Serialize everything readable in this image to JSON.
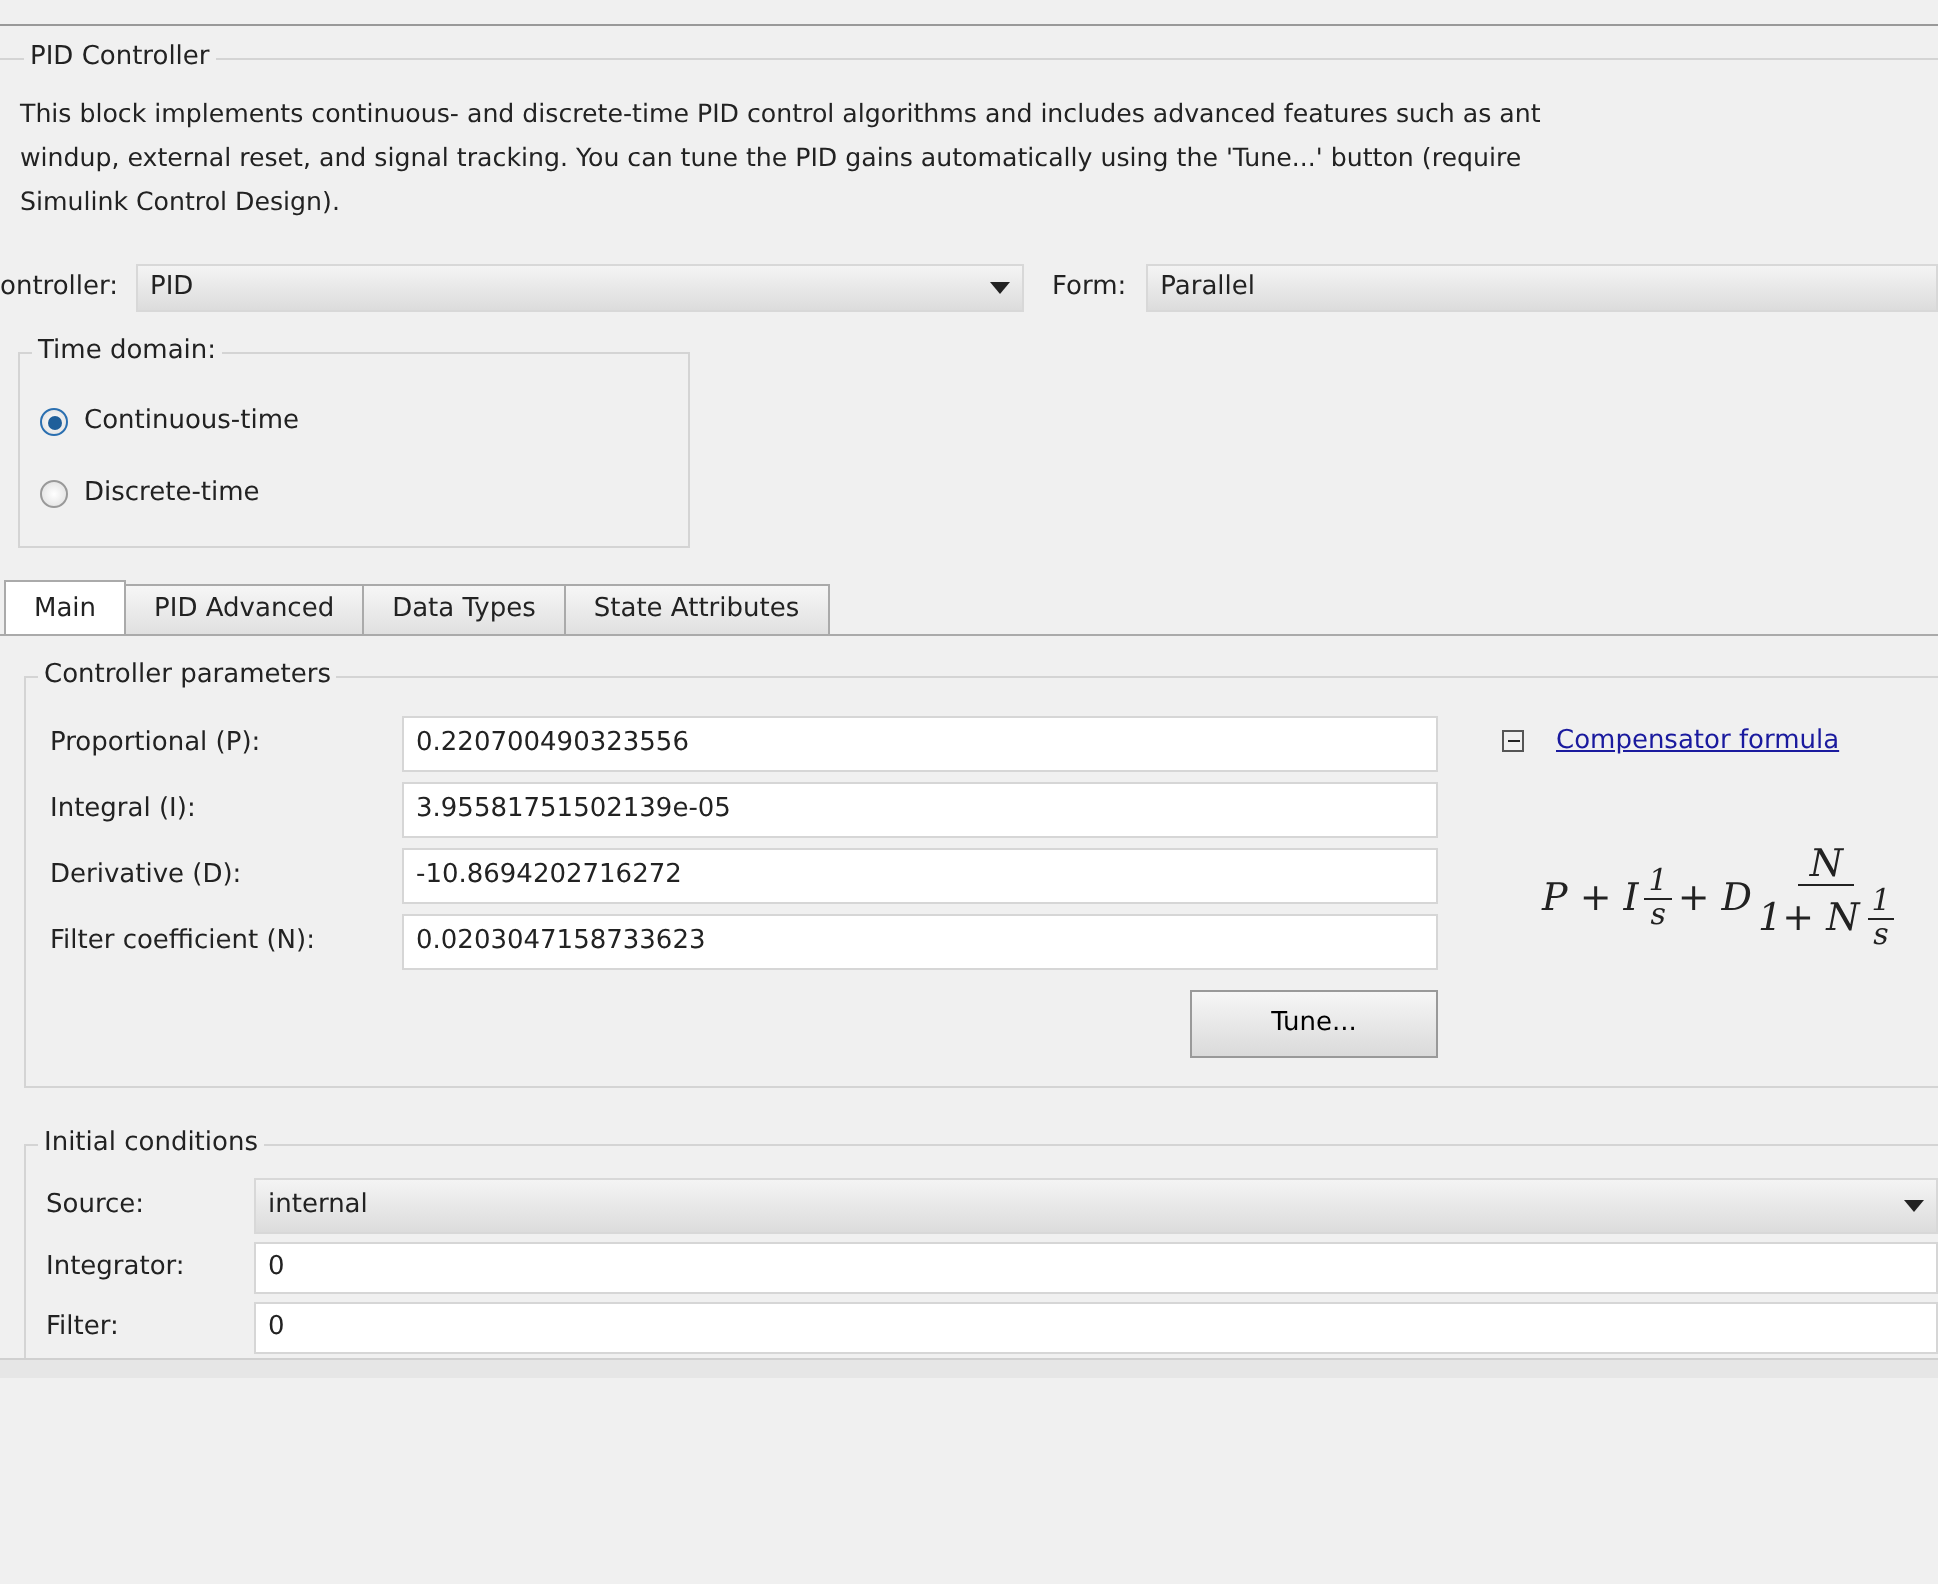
{
  "block": {
    "title": "PID Controller",
    "description_lines": [
      "This block implements continuous- and discrete-time PID control algorithms and includes advanced features such as ant",
      "windup, external reset, and signal tracking. You can tune the PID gains automatically using the 'Tune...' button (require",
      "Simulink Control Design)."
    ]
  },
  "controller": {
    "label": "ontroller:",
    "value": "PID"
  },
  "form": {
    "label": "Form:",
    "value": "Parallel"
  },
  "time_domain": {
    "title": "Time domain:",
    "options": [
      {
        "label": "Continuous-time",
        "selected": true
      },
      {
        "label": "Discrete-time",
        "selected": false
      }
    ]
  },
  "tabs": [
    {
      "label": "Main",
      "selected": true
    },
    {
      "label": "PID Advanced",
      "selected": false
    },
    {
      "label": "Data Types",
      "selected": false
    },
    {
      "label": "State Attributes",
      "selected": false
    }
  ],
  "controller_parameters": {
    "title": "Controller parameters",
    "fields": [
      {
        "label": "Proportional (P):",
        "value": "0.220700490323556"
      },
      {
        "label": "Integral (I):",
        "value": "3.95581751502139e-05"
      },
      {
        "label": "Derivative (D):",
        "value": "-10.8694202716272"
      },
      {
        "label": "Filter coefficient (N):",
        "value": "0.0203047158733623"
      }
    ],
    "tune_button": "Tune...",
    "formula_link": {
      "label": "Compensator formula",
      "expanded": true
    },
    "formula": {
      "lead": "P + I",
      "frac1_num": "1",
      "frac1_den": "s",
      "mid": "+ D",
      "big_num": "N",
      "big_den": "1+ N",
      "frac2_num": "1",
      "frac2_den": "s"
    }
  },
  "initial_conditions": {
    "title": "Initial conditions",
    "source": {
      "label": "Source:",
      "value": "internal"
    },
    "fields": [
      {
        "label": "Integrator:",
        "value": "0"
      },
      {
        "label": "Filter:",
        "value": "0"
      }
    ]
  }
}
